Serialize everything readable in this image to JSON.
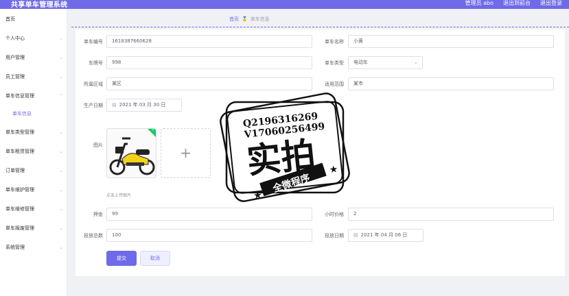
{
  "header": {
    "title": "共享单车管理系统",
    "nav": [
      "管理员 abo",
      "退出到前台",
      "退出登录"
    ]
  },
  "sidebar": {
    "items": [
      {
        "label": "首页",
        "arrow": false
      },
      {
        "label": "个人中心",
        "arrow": true
      },
      {
        "label": "用户管理",
        "arrow": true
      },
      {
        "label": "员工管理",
        "arrow": true
      },
      {
        "label": "单车信息管理",
        "arrow": true,
        "expanded": true
      },
      {
        "label": "单车信息",
        "sub": true
      },
      {
        "label": "单车类型管理",
        "arrow": true
      },
      {
        "label": "单车租赁管理",
        "arrow": true
      },
      {
        "label": "订单管理",
        "arrow": true
      },
      {
        "label": "单车维护管理",
        "arrow": true
      },
      {
        "label": "单车维修管理",
        "arrow": true
      },
      {
        "label": "单车报废管理",
        "arrow": true
      },
      {
        "label": "系统管理",
        "arrow": true
      }
    ]
  },
  "breadcrumb": {
    "home": "首页",
    "icon": "medal-icon",
    "current": "单车信息"
  },
  "form": {
    "bike_no_label": "单车编号",
    "bike_no": "1618387660628",
    "bike_name_label": "单车名称",
    "bike_name": "小黄",
    "plate_label": "车牌号",
    "plate": "998",
    "type_label": "单车类型",
    "type": "电动车",
    "area_label": "所属区域",
    "area": "某区",
    "scope_label": "适用范围",
    "scope": "某市",
    "prod_date_label": "生产日期",
    "prod_date": "2021 年 03 月 30 日",
    "image_label": "图片",
    "upload_hint": "点击上传图片",
    "deposit_label": "押金",
    "deposit": "99",
    "hourly_label": "小时价格",
    "hourly": "2",
    "total_label": "投放总数",
    "total": "100",
    "launch_date_label": "投放日期",
    "launch_date": "2021 年 04 月 06 日",
    "submit": "提交",
    "cancel": "取消"
  },
  "watermark": {
    "line1": "Q2196316269",
    "line2": "V17060256499",
    "big": "实拍",
    "banner": "全微程序"
  },
  "colors": {
    "accent": "#6f6ae8",
    "bike": "#f2d21a",
    "success": "#13ce66"
  }
}
